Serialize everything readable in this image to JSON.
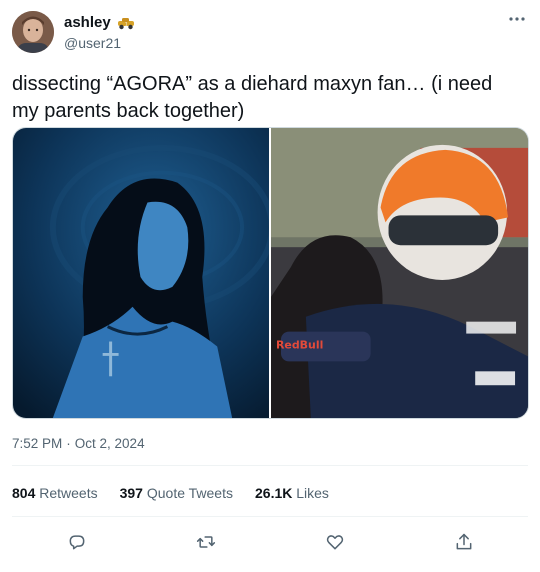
{
  "author": {
    "name": "ashley",
    "handle": "@user21",
    "name_emoji": "race-car-emoji"
  },
  "tweet": {
    "text": "dissecting “AGORA” as a diehard maxyn fan… (i need my parents back together)"
  },
  "media": [
    {
      "alt": "blue-toned photo of a woman with long dark hair and a cross necklace"
    },
    {
      "alt": "racing driver in helmet embracing a woman"
    }
  ],
  "meta": {
    "time": "7:52 PM",
    "separator": "·",
    "date": "Oct 2, 2024"
  },
  "stats": [
    {
      "count": "804",
      "label": "Retweets"
    },
    {
      "count": "397",
      "label": "Quote Tweets"
    },
    {
      "count": "26.1K",
      "label": "Likes"
    }
  ],
  "actions": [
    {
      "icon": "reply-icon"
    },
    {
      "icon": "retweet-icon"
    },
    {
      "icon": "like-icon"
    },
    {
      "icon": "share-icon"
    }
  ],
  "colors": {
    "text": "#0f1419",
    "secondary": "#536471",
    "divider": "#eff3f4",
    "border": "#cfd9de"
  }
}
